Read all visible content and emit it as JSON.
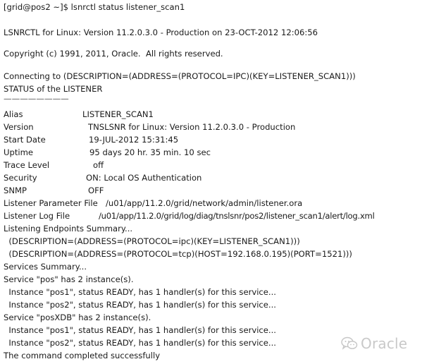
{
  "terminal": {
    "prompt_line": "[grid@pos2 ~]$ lsnrctl status listener_scan1",
    "banner": "LSNRCTL for Linux: Version 11.2.0.3.0 - Production on 23-OCT-2012 12:06:56",
    "copyright": "Copyright (c) 1991, 2011, Oracle.  All rights reserved.",
    "connecting": "Connecting to (DESCRIPTION=(ADDRESS=(PROTOCOL=IPC)(KEY=LISTENER_SCAN1)))",
    "status_heading": "STATUS of the LISTENER",
    "separator": "————————",
    "fields": {
      "alias": {
        "key": "Alias",
        "value": "LISTENER_SCAN1"
      },
      "version": {
        "key": "Version",
        "value": "TNSLSNR for Linux: Version 11.2.0.3.0 - Production"
      },
      "start_date": {
        "key": "Start Date",
        "value": "19-JUL-2012 15:31:45"
      },
      "uptime": {
        "key": "Uptime",
        "value": "95 days 20 hr. 35 min. 10 sec"
      },
      "trace_level": {
        "key": "Trace Level",
        "value": "off"
      },
      "security": {
        "key": "Security",
        "value": "ON: Local OS Authentication"
      },
      "snmp": {
        "key": "SNMP",
        "value": "OFF"
      },
      "param_file": {
        "key": "Listener Parameter File",
        "value": "/u01/app/11.2.0/grid/network/admin/listener.ora"
      },
      "log_file": {
        "key": "Listener Log File",
        "value": "/u01/app/11.2.0/grid/log/diag/tnslsnr/pos2/listener_scan1/alert/log.xml"
      }
    },
    "endpoints_heading": "Listening Endpoints Summary...",
    "endpoint_1": "  (DESCRIPTION=(ADDRESS=(PROTOCOL=ipc)(KEY=LISTENER_SCAN1)))",
    "endpoint_2": "  (DESCRIPTION=(ADDRESS=(PROTOCOL=tcp)(HOST=192.168.0.195)(PORT=1521)))",
    "services_heading": "Services Summary...",
    "service_pos": "Service \"pos\" has 2 instance(s).",
    "service_pos_inst1": "  Instance \"pos1\", status READY, has 1 handler(s) for this service...",
    "service_pos_inst2": "  Instance \"pos2\", status READY, has 1 handler(s) for this service...",
    "service_posxdb": "Service \"posXDB\" has 2 instance(s).",
    "service_posxdb_inst1": "  Instance \"pos1\", status READY, has 1 handler(s) for this service...",
    "service_posxdb_inst2": "  Instance \"pos2\", status READY, has 1 handler(s) for this service...",
    "completed": "The command completed successfully"
  },
  "watermark": {
    "text": "Oracle",
    "icon": "wechat-chat-bubbles-icon"
  }
}
